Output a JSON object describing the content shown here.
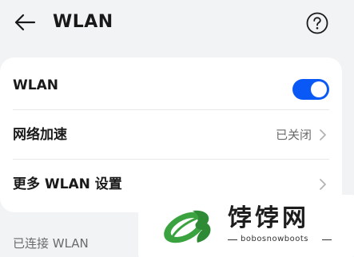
{
  "header": {
    "title": "WLAN",
    "back_icon": "arrow-left-icon",
    "help_icon": "question-circle-icon"
  },
  "settings": {
    "wlan": {
      "label": "WLAN",
      "enabled": true,
      "toggle_color": "#0a59f7"
    },
    "network_acceleration": {
      "label": "网络加速",
      "value": "已关闭"
    },
    "more_settings": {
      "label": "更多 WLAN 设置"
    }
  },
  "section": {
    "connected_label": "已连接 WLAN"
  },
  "watermark": {
    "name": "饽饽网",
    "subtitle": "bobosnowboots",
    "logo_color": "#3aa33f"
  }
}
